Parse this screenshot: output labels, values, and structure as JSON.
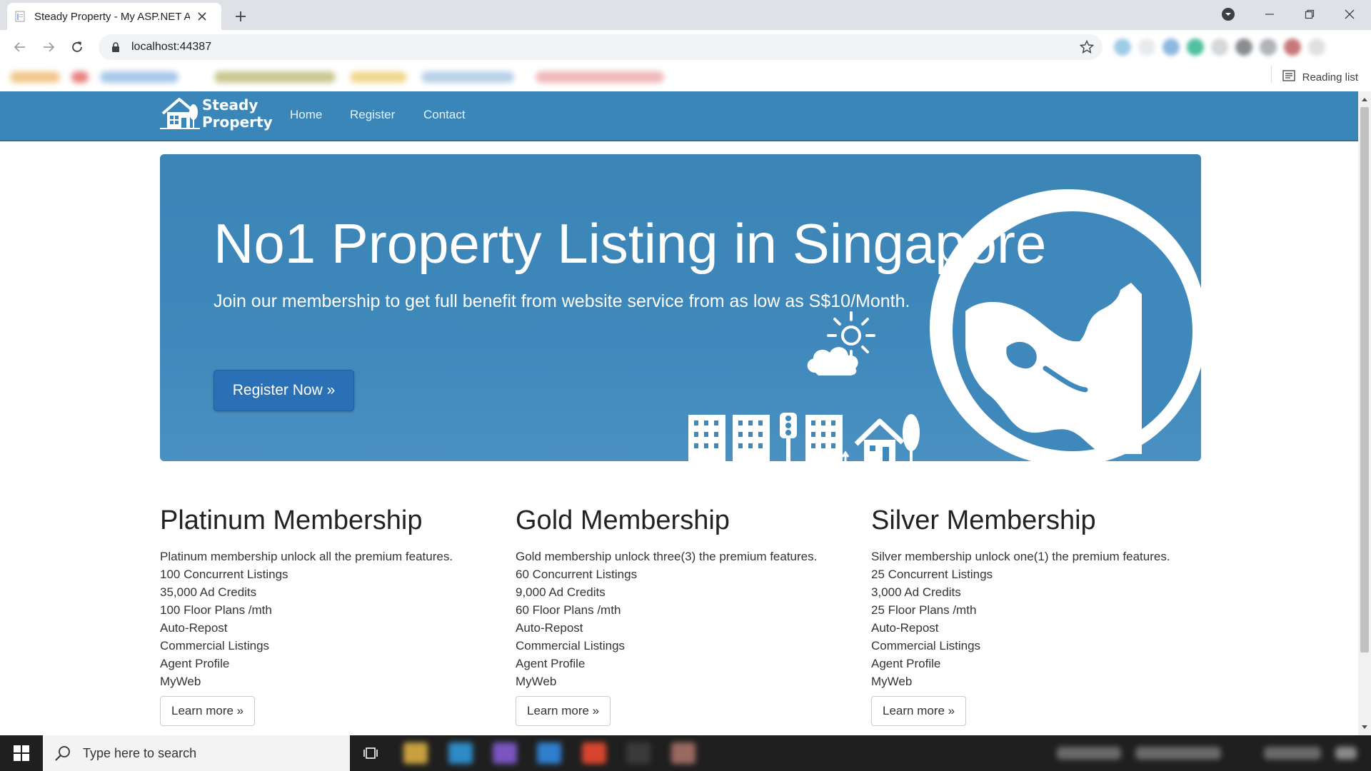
{
  "browser": {
    "tab_title": "Steady Property - My ASP.NET A",
    "url": "localhost:44387",
    "reading_list_label": "Reading list"
  },
  "site": {
    "brand": "Steady\nProperty",
    "nav": [
      "Home",
      "Register",
      "Contact"
    ]
  },
  "hero": {
    "title": "No1 Property Listing in Singapore",
    "subtitle": "Join our membership to get full benefit from website service from as low as S$10/Month.",
    "cta_label": "Register Now »"
  },
  "memberships": [
    {
      "heading": "Platinum Membership",
      "lines": [
        "Platinum membership unlock all the premium features.",
        "100 Concurrent Listings",
        "35,000 Ad Credits",
        "100 Floor Plans /mth",
        "Auto-Repost",
        "Commercial Listings",
        "Agent Profile",
        "MyWeb"
      ],
      "button": "Learn more »"
    },
    {
      "heading": "Gold Membership",
      "lines": [
        "Gold membership unlock three(3) the premium features.",
        "60 Concurrent Listings",
        "9,000 Ad Credits",
        "60 Floor Plans /mth",
        "Auto-Repost",
        "Commercial Listings",
        "Agent Profile",
        "MyWeb"
      ],
      "button": "Learn more »"
    },
    {
      "heading": "Silver Membership",
      "lines": [
        "Silver membership unlock one(1) the premium features.",
        "25 Concurrent Listings",
        "3,000 Ad Credits",
        "25 Floor Plans /mth",
        "Auto-Repost",
        "Commercial Listings",
        "Agent Profile",
        "MyWeb"
      ],
      "button": "Learn more »"
    }
  ],
  "taskbar": {
    "search_placeholder": "Type here to search"
  },
  "colors": {
    "nav_bg": "#3a86b8",
    "hero_bg": "#3f88bb",
    "cta_bg": "#2a70b7"
  }
}
